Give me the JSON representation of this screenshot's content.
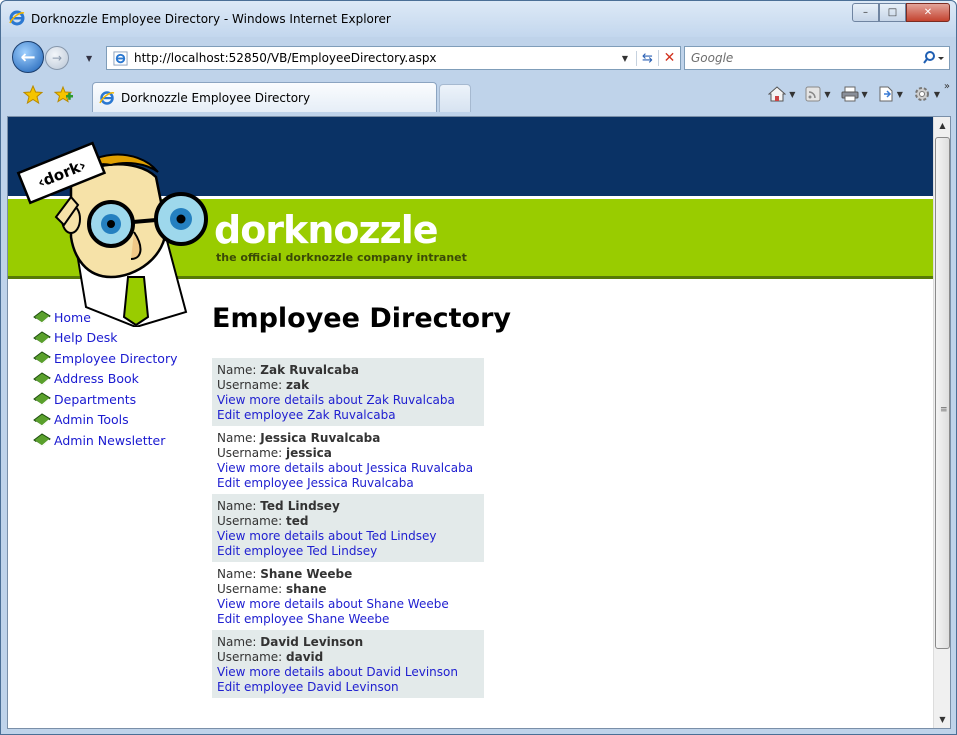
{
  "window": {
    "title": "Dorknozzle Employee Directory - Windows Internet Explorer",
    "controls": {
      "minimize": "–",
      "maximize": "□",
      "close": "✕"
    }
  },
  "address_bar": {
    "url": "http://localhost:52850/VB/EmployeeDirectory.aspx"
  },
  "search_box": {
    "placeholder": "Google"
  },
  "tab": {
    "title": "Dorknozzle Employee Directory"
  },
  "site": {
    "logo_text": "‹dork›",
    "brand": "dorknozzle",
    "tagline": "the official dorknozzle company intranet",
    "colors": {
      "header_dark": "#0a3265",
      "header_green": "#99cc00",
      "link": "#2020d0",
      "row_alt": "#e3eaea"
    }
  },
  "nav": {
    "items": [
      {
        "label": "Home"
      },
      {
        "label": "Help Desk"
      },
      {
        "label": "Employee Directory"
      },
      {
        "label": "Address Book"
      },
      {
        "label": "Departments"
      },
      {
        "label": "Admin Tools"
      },
      {
        "label": "Admin Newsletter"
      }
    ]
  },
  "main": {
    "title": "Employee Directory",
    "name_label": "Name: ",
    "username_label": "Username: ",
    "employees": [
      {
        "name": "Zak Ruvalcaba",
        "username": "zak",
        "details_link": "View more details about Zak Ruvalcaba",
        "edit_link": "Edit employee Zak Ruvalcaba"
      },
      {
        "name": "Jessica Ruvalcaba",
        "username": "jessica",
        "details_link": "View more details about Jessica Ruvalcaba",
        "edit_link": "Edit employee Jessica Ruvalcaba"
      },
      {
        "name": "Ted Lindsey",
        "username": "ted",
        "details_link": "View more details about Ted Lindsey",
        "edit_link": "Edit employee Ted Lindsey"
      },
      {
        "name": "Shane Weebe",
        "username": "shane",
        "details_link": "View more details about Shane Weebe",
        "edit_link": "Edit employee Shane Weebe"
      },
      {
        "name": "David Levinson",
        "username": "david",
        "details_link": "View more details about David Levinson",
        "edit_link": "Edit employee David Levinson"
      }
    ]
  }
}
